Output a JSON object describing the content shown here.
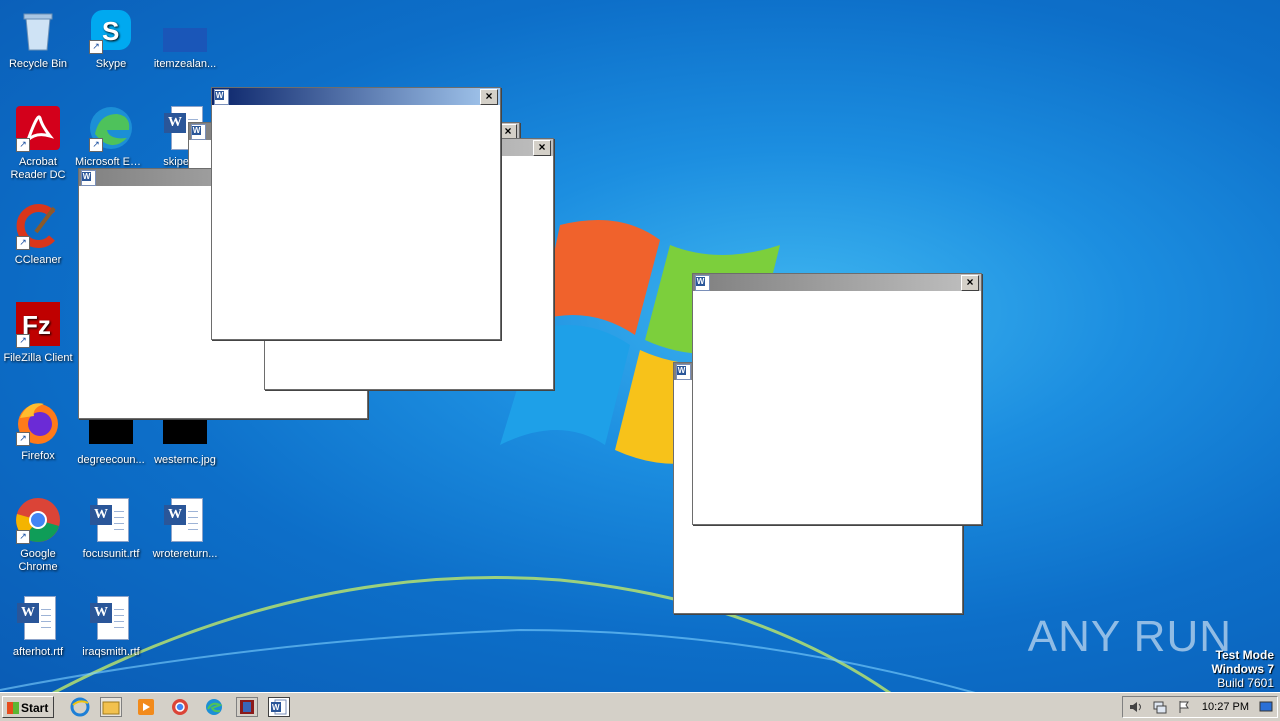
{
  "desktop": {
    "icons": {
      "recycle_bin": "Recycle Bin",
      "skype": "Skype",
      "itemzealan": "itemzealan...",
      "acrobat": "Acrobat Reader DC",
      "edge": "Microsoft Edge",
      "skipele": "skipele...",
      "ccleaner": "CCleaner",
      "filezilla": "FileZilla Client",
      "firefox": "Firefox",
      "degreecount": "degreecoun...",
      "westernc": "westernc.jpg",
      "chrome": "Google Chrome",
      "focusunit": "focusunit.rtf",
      "wrotereturn": "wrotereturn...",
      "afterhot": "afterhot.rtf",
      "iraqsmith": "iraqsmith.rtf"
    }
  },
  "watermark": "ANY RUN",
  "test_mode": {
    "line1": "Test Mode",
    "line2": "Windows 7",
    "line3": "Build 7601"
  },
  "taskbar": {
    "start_label": "Start",
    "clock": "10:27 PM"
  },
  "colors": {
    "active_title": "#0a246a",
    "inactive_title": "#808080",
    "taskbar": "#d4d0c8"
  }
}
